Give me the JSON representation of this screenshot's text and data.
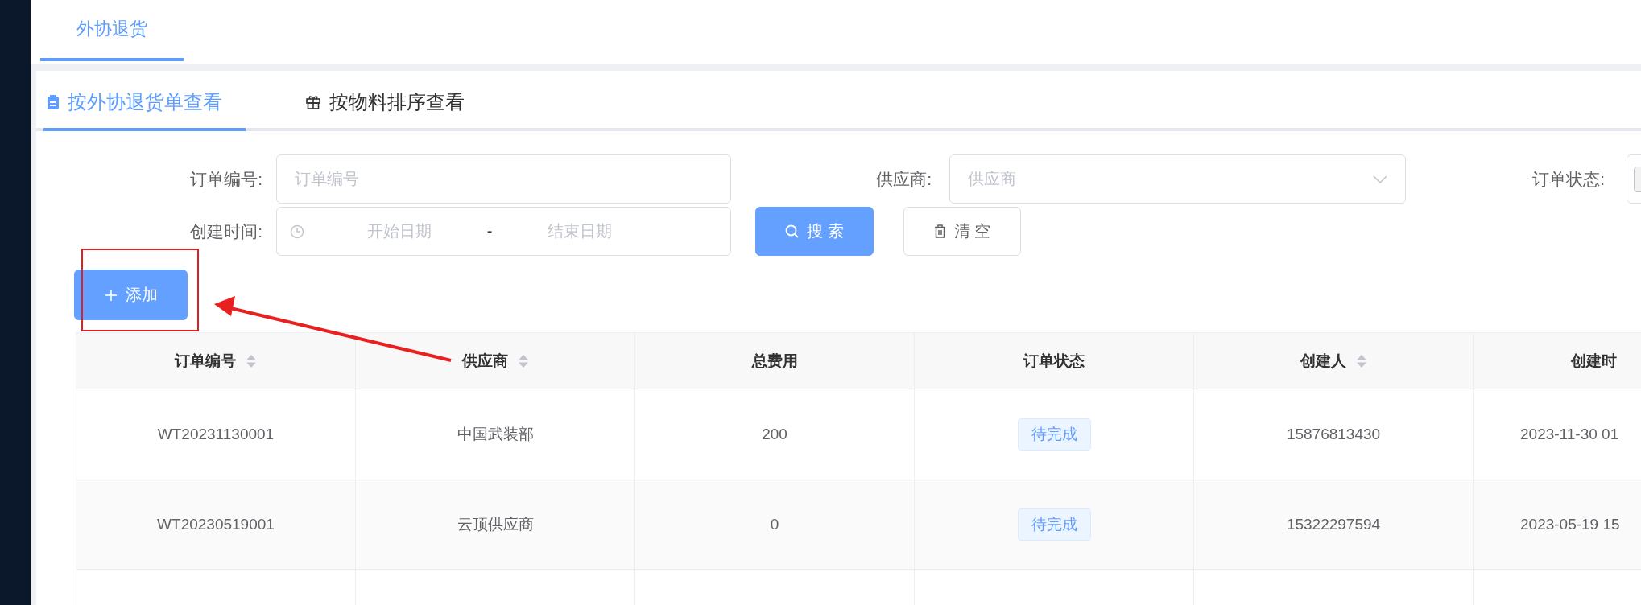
{
  "top_tabs": [
    {
      "label": "外协退货",
      "selected": true
    }
  ],
  "view_tabs": [
    {
      "label": "按外协退货单查看",
      "kind": "document",
      "selected": true
    },
    {
      "label": "按物料排序查看",
      "kind": "material",
      "selected": false
    }
  ],
  "filters": {
    "order_no": {
      "label": "订单编号:",
      "placeholder": "订单编号"
    },
    "supplier": {
      "label": "供应商:",
      "placeholder": "供应商"
    },
    "status": {
      "label": "订单状态:"
    },
    "created": {
      "label": "创建时间:",
      "start_placeholder": "开始日期",
      "separator": "-",
      "end_placeholder": "结束日期"
    }
  },
  "buttons": {
    "search": "搜 索",
    "clear": "清 空",
    "add": "添加"
  },
  "table": {
    "columns": [
      {
        "label": "订单编号",
        "sortable": true
      },
      {
        "label": "供应商",
        "sortable": true
      },
      {
        "label": "总费用",
        "sortable": false
      },
      {
        "label": "订单状态",
        "sortable": false
      },
      {
        "label": "创建人",
        "sortable": true
      },
      {
        "label": "创建时",
        "sortable": false
      }
    ],
    "rows": [
      {
        "order_no": "WT20231130001",
        "supplier": "中国武装部",
        "total": "200",
        "status": "待完成",
        "creator": "15876813430",
        "created": "2023-11-30 01"
      },
      {
        "order_no": "WT20230519001",
        "supplier": "云顶供应商",
        "total": "0",
        "status": "待完成",
        "creator": "15322297594",
        "created": "2023-05-19 15"
      }
    ]
  }
}
